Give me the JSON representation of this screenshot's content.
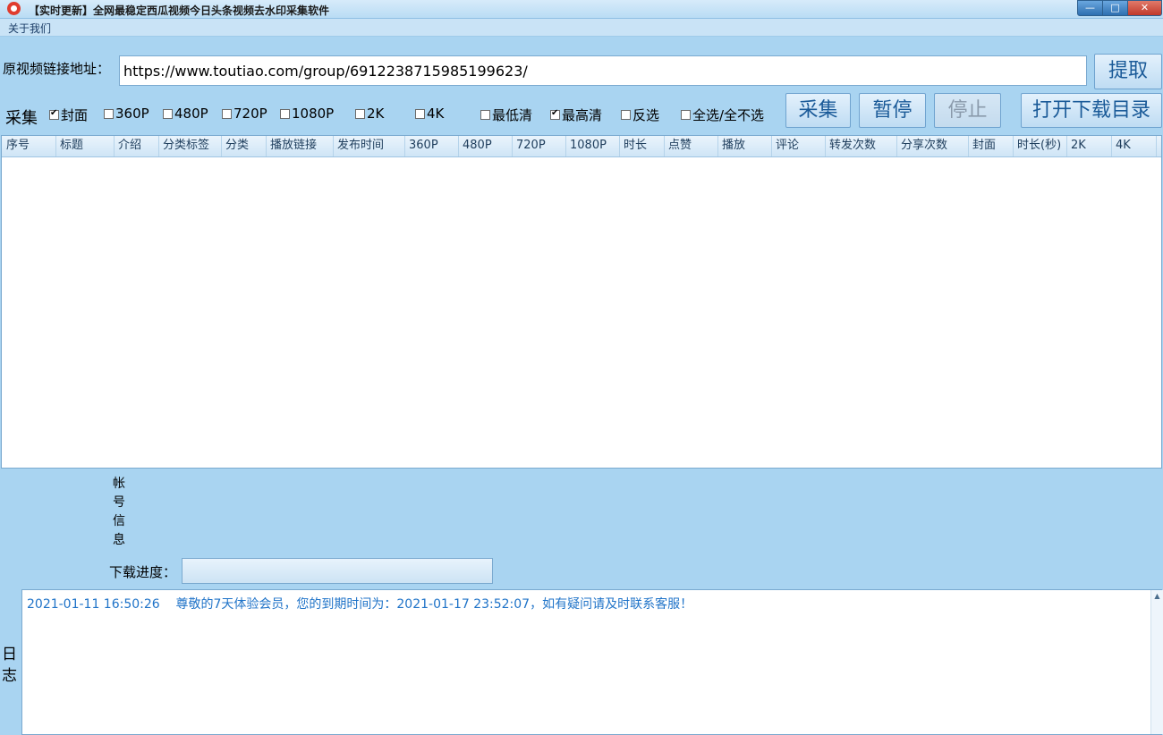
{
  "window": {
    "title": "【实时更新】全网最稳定西瓜视频今日头条视频去水印采集软件",
    "controls": {
      "minimize": "—",
      "maximize": "□",
      "close": "✕"
    }
  },
  "menu": {
    "about": "关于我们"
  },
  "url_row": {
    "label": "原视频链接地址：",
    "value": "https://www.toutiao.com/group/6912238715985199623/",
    "extract_button": "提取"
  },
  "options": {
    "collect_label": "采集",
    "checkboxes": [
      {
        "label": "封面",
        "checked": true
      },
      {
        "label": "360P",
        "checked": false
      },
      {
        "label": "480P",
        "checked": false
      },
      {
        "label": "720P",
        "checked": false
      },
      {
        "label": "1080P",
        "checked": false
      },
      {
        "label": "2K",
        "checked": false
      },
      {
        "label": "4K",
        "checked": false
      },
      {
        "label": "最低清",
        "checked": false
      },
      {
        "label": "最高清",
        "checked": true
      },
      {
        "label": "反选",
        "checked": false
      },
      {
        "label": "全选/全不选",
        "checked": false
      }
    ],
    "buttons": {
      "collect": "采集",
      "pause": "暂停",
      "stop": "停止",
      "open_dir": "打开下载目录"
    }
  },
  "table": {
    "columns": [
      "序号",
      "标题",
      "介绍",
      "分类标签",
      "分类",
      "播放链接",
      "发布时间",
      "360P",
      "480P",
      "720P",
      "1080P",
      "时长",
      "点赞",
      "播放",
      "评论",
      "转发次数",
      "分享次数",
      "封面",
      "时长(秒)",
      "2K",
      "4K"
    ],
    "rows": []
  },
  "account": {
    "label": "帐号信息",
    "progress_label": "下载进度：",
    "progress": 0
  },
  "log": {
    "label": "日志",
    "lines": [
      "2021-01-11 16:50:26    尊敬的7天体验会员，您的到期时间为：2021-01-17 23:52:07，如有疑问请及时联系客服！"
    ]
  }
}
